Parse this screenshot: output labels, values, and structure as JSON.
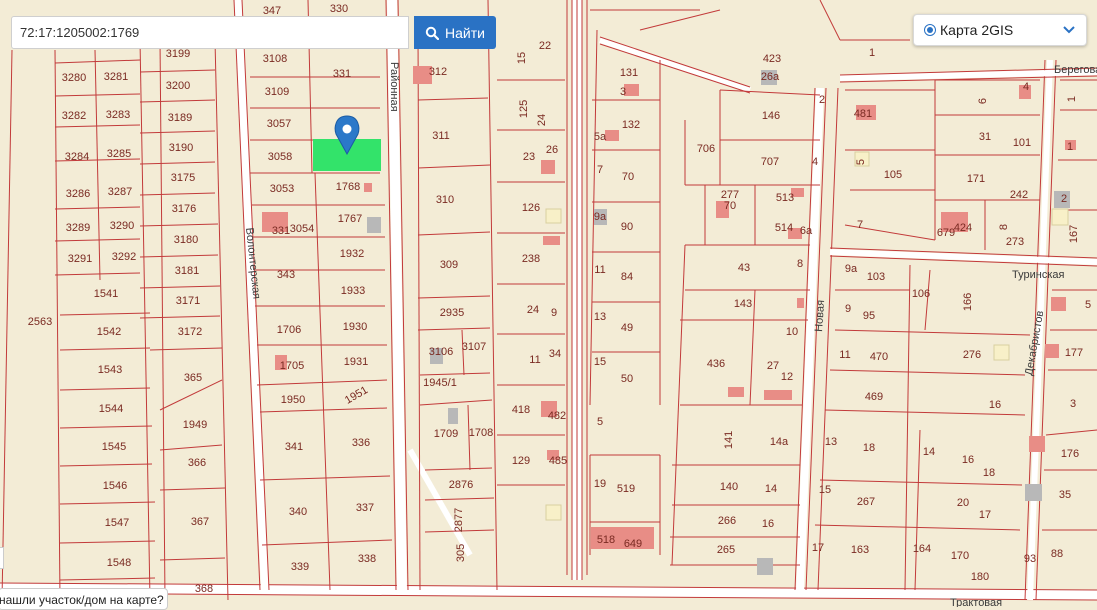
{
  "search": {
    "value": "72:17:1205002:1769",
    "button_label": "Найти"
  },
  "layer": {
    "label": "Карта 2GIS"
  },
  "note": {
    "text": "нашли участок/дом на карте?"
  },
  "map": {
    "streets": [
      "Волонтерская",
      "Новая",
      "Береговая",
      "Туринская",
      "Декабристов",
      "Трактовая",
      "Районная"
    ],
    "parcels": [
      "347",
      "330",
      "3108",
      "331",
      "3199",
      "3280",
      "3281",
      "3200",
      "3109",
      "3282",
      "3283",
      "3189",
      "3057",
      "3284",
      "3285",
      "3190",
      "3058",
      "1768",
      "3175",
      "3286",
      "3287",
      "3053",
      "3176",
      "3289",
      "3290",
      "1767",
      "3054",
      "331",
      "3180",
      "3291",
      "3292",
      "1932",
      "3181",
      "343",
      "1933",
      "3171",
      "1541",
      "1706",
      "1930",
      "3172",
      "1542",
      "1705",
      "1931",
      "365",
      "1543",
      "1950",
      "1951",
      "1544",
      "1949",
      "341",
      "336",
      "366",
      "1545",
      "1546",
      "340",
      "337",
      "367",
      "1547",
      "339",
      "338",
      "1548",
      "368",
      "2563",
      "312",
      "311",
      "310",
      "309",
      "2935",
      "3106",
      "3107",
      "1945/1",
      "1709",
      "1708",
      "2876",
      "2877",
      "305",
      "15",
      "22",
      "125",
      "24",
      "23",
      "26",
      "126",
      "238",
      "24",
      "9",
      "11",
      "34",
      "418",
      "482",
      "129",
      "485",
      "131",
      "3",
      "132",
      "5а",
      "7",
      "70",
      "9а",
      "90",
      "11",
      "84",
      "13",
      "49",
      "15",
      "50",
      "5",
      "19",
      "519",
      "518",
      "649",
      "423",
      "26а",
      "2",
      "146",
      "706",
      "707",
      "4",
      "277",
      "70",
      "513",
      "514",
      "6а",
      "43",
      "8",
      "143",
      "10",
      "436",
      "27",
      "12",
      "141",
      "14а",
      "140",
      "14",
      "266",
      "16",
      "265",
      "481",
      "1",
      "105",
      "5",
      "7",
      "9а",
      "103",
      "9",
      "95",
      "106",
      "11",
      "470",
      "469",
      "13",
      "18",
      "15",
      "267",
      "17",
      "163",
      "164",
      "170",
      "171",
      "31",
      "6",
      "242",
      "679",
      "424",
      "8",
      "273",
      "167",
      "166",
      "276",
      "14",
      "16",
      "16",
      "18",
      "20",
      "17",
      "180",
      "93",
      "88",
      "35",
      "176",
      "177",
      "5",
      "3",
      "2",
      "1",
      "4",
      "1",
      "101"
    ]
  }
}
